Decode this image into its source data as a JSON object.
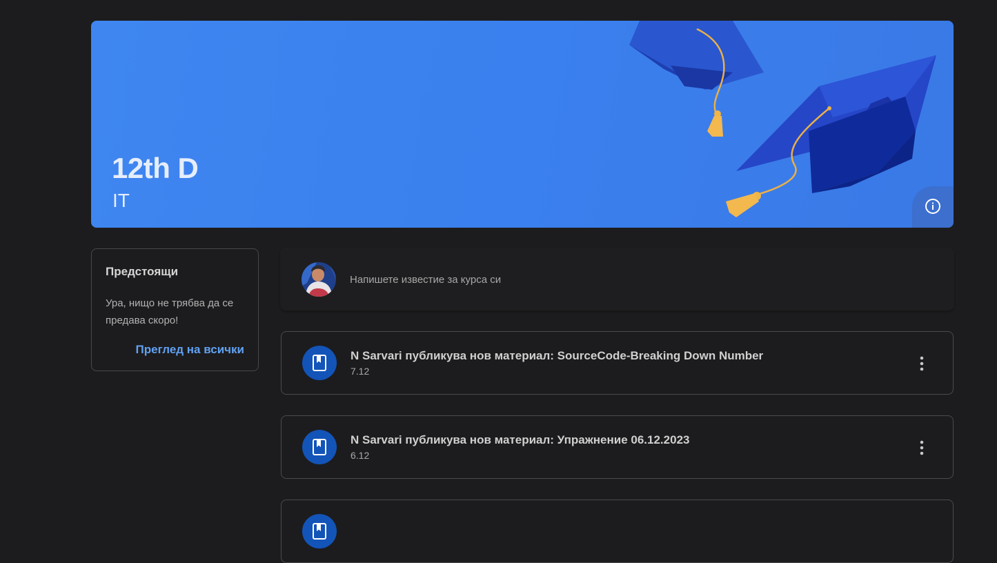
{
  "banner": {
    "title": "12th D",
    "subtitle": "IT",
    "accent_color": "#3f86f0",
    "info_icon": "info-icon"
  },
  "upcoming": {
    "title": "Предстоящи",
    "message": "Ура, нищо не трябва да се предава скоро!",
    "view_all_label": "Преглед на всички"
  },
  "composer": {
    "placeholder": "Напишете известие за курса си",
    "avatar_icon": "user-avatar"
  },
  "posts": [
    {
      "title": "N Sarvari публикува нов материал: SourceCode-Breaking Down Number",
      "date": "7.12",
      "icon": "material-book-icon",
      "menu_icon": "more-vert-icon"
    },
    {
      "title": "N Sarvari публикува нов материал: Упражнение 06.12.2023",
      "date": "6.12",
      "icon": "material-book-icon",
      "menu_icon": "more-vert-icon"
    },
    {
      "title": "",
      "date": "",
      "icon": "material-book-icon",
      "menu_icon": "more-vert-icon"
    }
  ]
}
